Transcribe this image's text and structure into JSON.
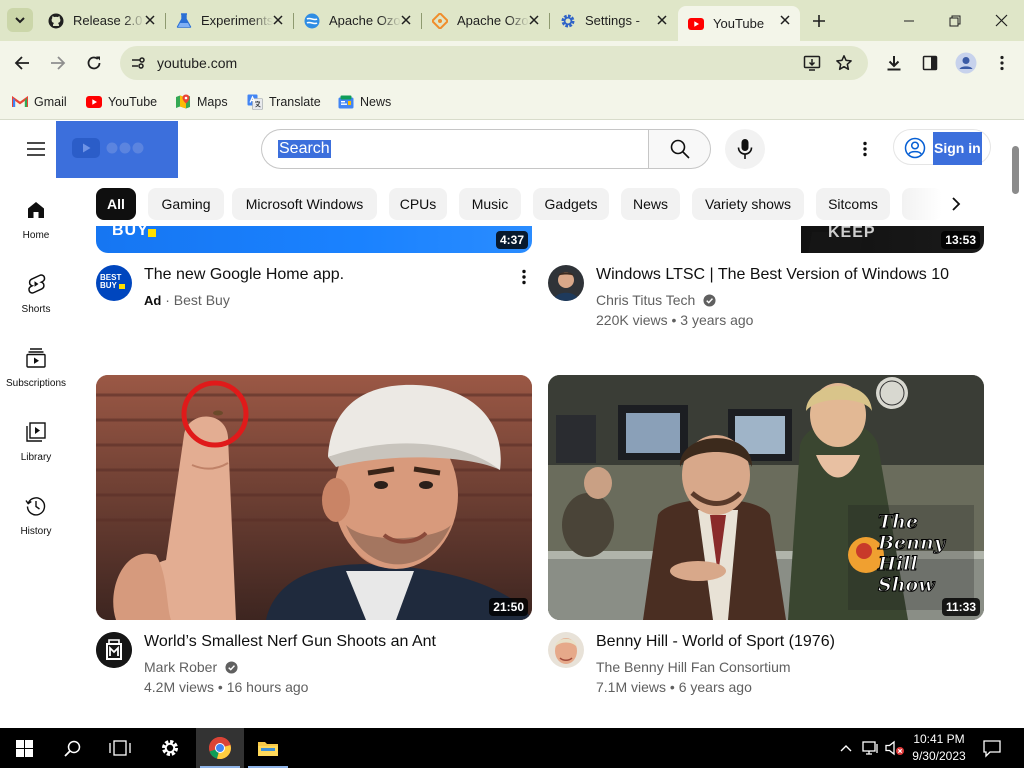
{
  "browser": {
    "tabs": [
      {
        "label": "Release 2.0",
        "icon": "github-icon"
      },
      {
        "label": "Experiments",
        "icon": "flask-icon"
      },
      {
        "label": "Apache Ozone",
        "icon": "apache-ozone-icon"
      },
      {
        "label": "Apache Ozone",
        "icon": "git-diamond-icon"
      },
      {
        "label": "Settings - ",
        "icon": "settings-gear-icon"
      },
      {
        "label": "YouTube",
        "icon": "youtube-icon",
        "active": true
      }
    ],
    "url": "youtube.com",
    "bookmarks": [
      {
        "label": "Gmail",
        "icon": "gmail-icon"
      },
      {
        "label": "YouTube",
        "icon": "youtube-icon"
      },
      {
        "label": "Maps",
        "icon": "maps-icon"
      },
      {
        "label": "Translate",
        "icon": "translate-icon"
      },
      {
        "label": "News",
        "icon": "news-icon"
      }
    ],
    "colors": {
      "frame": "#dfe6c8",
      "toolbar": "#f3f5e9",
      "omnibox": "#e1e7cd",
      "selection": "#3c6fdc"
    }
  },
  "youtube": {
    "search_placeholder": "Search",
    "sign_in": "Sign in",
    "chips": [
      "All",
      "Gaming",
      "Microsoft Windows",
      "CPUs",
      "Music",
      "Gadgets",
      "News",
      "Variety shows",
      "Sitcoms"
    ],
    "active_chip": "All",
    "guide": [
      {
        "label": "Home",
        "icon": "home-icon"
      },
      {
        "label": "Shorts",
        "icon": "shorts-icon"
      },
      {
        "label": "Subscriptions",
        "icon": "subscriptions-icon"
      },
      {
        "label": "Library",
        "icon": "library-icon"
      },
      {
        "label": "History",
        "icon": "history-icon"
      }
    ],
    "videos": [
      {
        "title": "The new Google Home app.",
        "ad": "Ad",
        "channel": "Best Buy",
        "duration": "4:37",
        "verified": false
      },
      {
        "title": "Windows LTSC | The Best Version of Windows 10",
        "channel": "Chris Titus Tech",
        "views": "220K views",
        "age": "3 years ago",
        "duration": "13:53",
        "verified": true
      },
      {
        "title": "World’s Smallest Nerf Gun Shoots an Ant",
        "channel": "Mark Rober",
        "views": "4.2M views",
        "age": "16 hours ago",
        "duration": "21:50",
        "verified": true
      },
      {
        "title": "Benny Hill - World of Sport (1976)",
        "channel": "The Benny Hill Fan Consortium",
        "views": "7.1M views",
        "age": "6 years ago",
        "duration": "11:33",
        "verified": false
      }
    ],
    "thumbnail_text": {
      "best_buy_avatar": "BEST BUY",
      "benny_hill_show": "The Benny Hill Show",
      "partial_top_left": "BUY",
      "partial_top_right": "KEEP"
    }
  },
  "taskbar": {
    "time": "10:41 PM",
    "date": "9/30/2023",
    "apps": [
      "start-icon",
      "search-icon",
      "task-view-icon",
      "settings-icon",
      "chrome-icon",
      "file-explorer-icon"
    ]
  }
}
